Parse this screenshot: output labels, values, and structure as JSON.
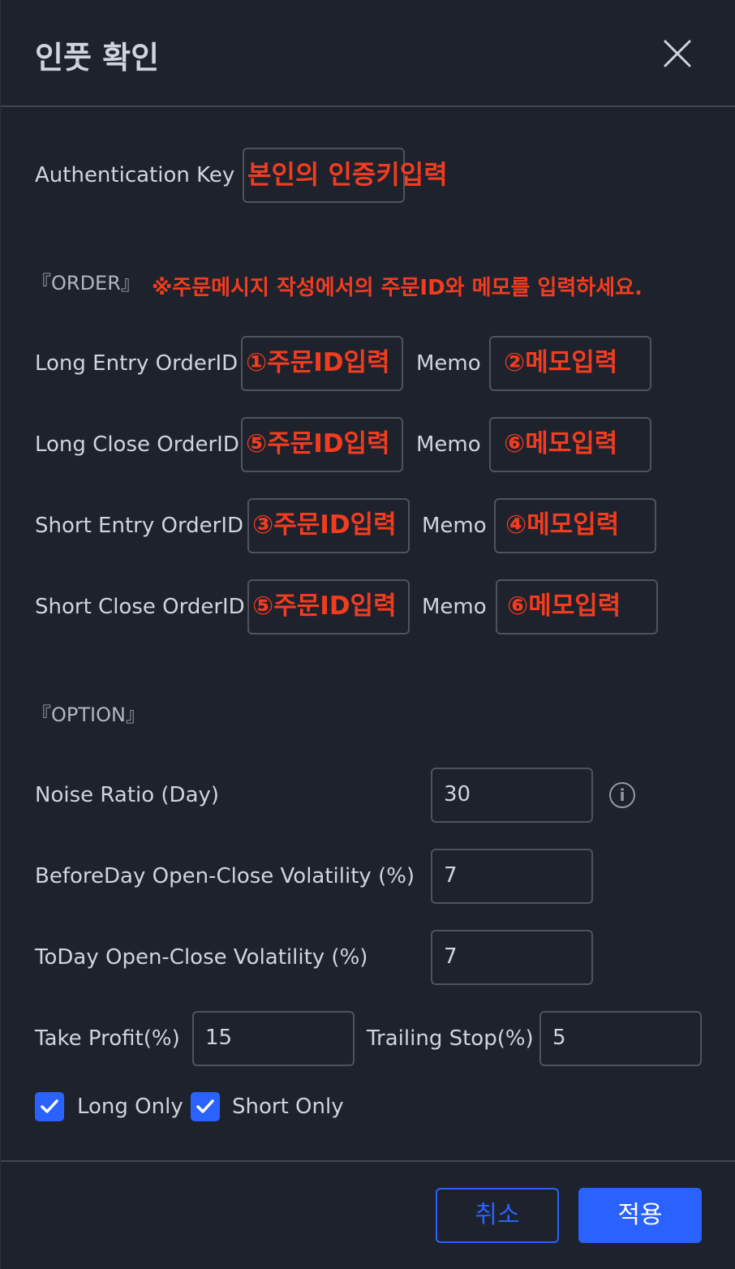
{
  "dialog": {
    "title": "인풋 확인"
  },
  "auth": {
    "label": "Authentication Key",
    "value": "본인의 인증키입력"
  },
  "order": {
    "section_label": "『ORDER』",
    "note": "※주문메시지 작성에서의 주문ID와 메모를 입력하세요.",
    "memo_label": "Memo",
    "rows": [
      {
        "label": "Long Entry OrderID",
        "order_id": "①주문ID입력",
        "memo": "②메모입력"
      },
      {
        "label": "Long Close OrderID",
        "order_id": "⑤주문ID입력",
        "memo": "⑥메모입력"
      },
      {
        "label": "Short Entry OrderID",
        "order_id": "③주문ID입력",
        "memo": "④메모입력"
      },
      {
        "label": "Short Close OrderID",
        "order_id": "⑤주문ID입력",
        "memo": "⑥메모입력"
      }
    ]
  },
  "option": {
    "section_label": "『OPTION』",
    "noise_ratio": {
      "label": "Noise Ratio (Day)",
      "value": "30"
    },
    "before_day_vol": {
      "label": "BeforeDay Open-Close Volatility (%)",
      "value": "7"
    },
    "today_vol": {
      "label": "ToDay Open-Close Volatility (%)",
      "value": "7"
    },
    "take_profit": {
      "label": "Take Profit(%)",
      "value": "15"
    },
    "trailing_stop": {
      "label": "Trailing Stop(%)",
      "value": "5"
    },
    "long_only": {
      "label": "Long Only",
      "checked": true
    },
    "short_only": {
      "label": "Short Only",
      "checked": true
    }
  },
  "footer": {
    "cancel_label": "취소",
    "apply_label": "적용"
  },
  "colors": {
    "background": "#1e222d",
    "accent": "#2962ff",
    "annotation": "#f23c1f"
  },
  "icons": {
    "close": "close-icon",
    "info": "info-icon",
    "check": "check-icon"
  }
}
